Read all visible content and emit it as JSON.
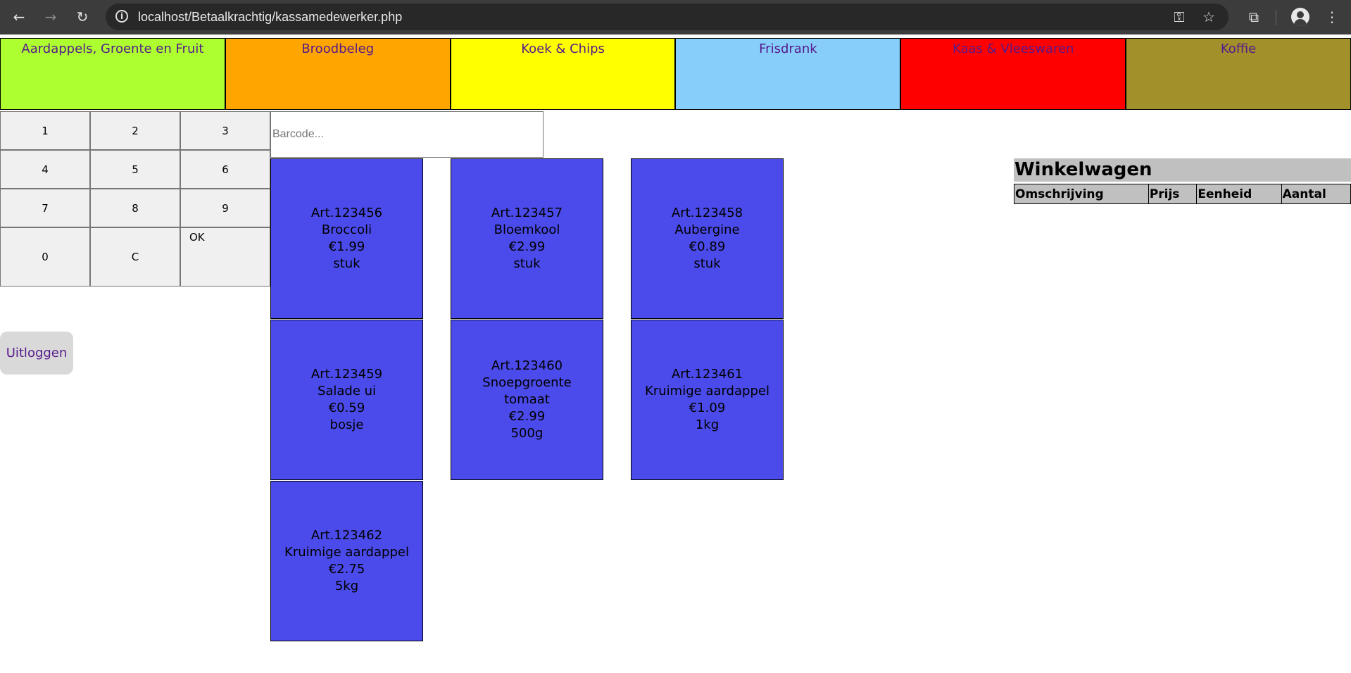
{
  "browser": {
    "url_host": "localhost",
    "url_path": "/Betaalkrachtig/kassamedewerker.php"
  },
  "categories": [
    {
      "label": "Aardappels, Groente en Fruit",
      "bg": "#adff2f",
      "color": "#551a8b"
    },
    {
      "label": "Broodbeleg",
      "bg": "#ffa500",
      "color": "#551a8b"
    },
    {
      "label": "Koek & Chips",
      "bg": "#ffff00",
      "color": "#551a8b"
    },
    {
      "label": "Frisdrank",
      "bg": "#87cefa",
      "color": "#551a8b"
    },
    {
      "label": "Kaas & Vleeswaren",
      "bg": "#ff0000",
      "color": "#551a8b"
    },
    {
      "label": "Koffie",
      "bg": "#a2902a",
      "color": "#551a8b"
    }
  ],
  "numpad": {
    "keys": [
      "1",
      "2",
      "3",
      "4",
      "5",
      "6",
      "7",
      "8",
      "9",
      "0",
      "C",
      "OK"
    ]
  },
  "logout_label": "Uitloggen",
  "barcode": {
    "placeholder": "Barcode..."
  },
  "products": [
    {
      "article": "Art.123456",
      "name": "Broccoli",
      "price": "€1.99",
      "unit": "stuk"
    },
    {
      "article": "Art.123457",
      "name": "Bloemkool",
      "price": "€2.99",
      "unit": "stuk"
    },
    {
      "article": "Art.123458",
      "name": "Aubergine",
      "price": "€0.89",
      "unit": "stuk"
    },
    {
      "article": "Art.123459",
      "name": "Salade ui",
      "price": "€0.59",
      "unit": "bosje"
    },
    {
      "article": "Art.123460",
      "name": "Snoepgroente tomaat",
      "price": "€2.99",
      "unit": "500g"
    },
    {
      "article": "Art.123461",
      "name": "Kruimige aardappel",
      "price": "€1.09",
      "unit": "1kg"
    },
    {
      "article": "Art.123462",
      "name": "Kruimige aardappel",
      "price": "€2.75",
      "unit": "5kg"
    }
  ],
  "cart": {
    "title": "Winkelwagen",
    "columns": [
      "Omschrijving",
      "Prijs",
      "Eenheid",
      "Aantal"
    ]
  }
}
